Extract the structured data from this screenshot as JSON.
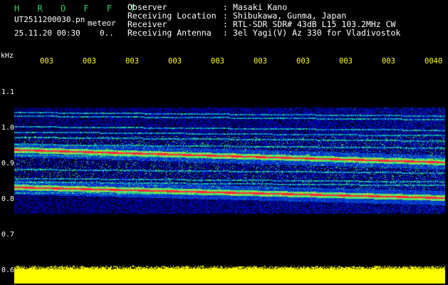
{
  "header": {
    "title": "H R O F F T",
    "file_name": "UT2511200030.pn",
    "meteor_label": "meteor",
    "date_time": "25.11.20 00:30",
    "code": "0.."
  },
  "station_info": [
    {
      "label": "Observer",
      "value": "Masaki Kano"
    },
    {
      "label": "Receiving Location",
      "value": "Shibukawa, Gunma, Japan"
    },
    {
      "label": "Receiver",
      "value": "RTL-SDR SDR# 43dB L15 103.2MHz CW"
    },
    {
      "label": "Receiving Antenna",
      "value": "3el Yagi(V) Az 330 for Vladivostok"
    }
  ],
  "separator": ":",
  "y_axis": {
    "unit": "kHz",
    "ticks": [
      "1.1",
      "1.0",
      "0.9",
      "0.8",
      "0.7",
      "0.6"
    ]
  },
  "x_axis": {
    "ticks": [
      "003",
      "003",
      "003",
      "003",
      "003",
      "003",
      "003",
      "003",
      "003",
      "0040"
    ]
  },
  "colors": {
    "background": "#000000",
    "title": "#2fd06a",
    "text": "#ffffff",
    "time_ticks": "#ffff00",
    "noise_floor": "#0a1ea8",
    "signal_peak": "#ff2a3c"
  },
  "signal_trace": {
    "carrier_lines_khz_start": [
      0.94,
      0.835
    ],
    "carrier_lines_khz_end": [
      0.905,
      0.805
    ]
  }
}
